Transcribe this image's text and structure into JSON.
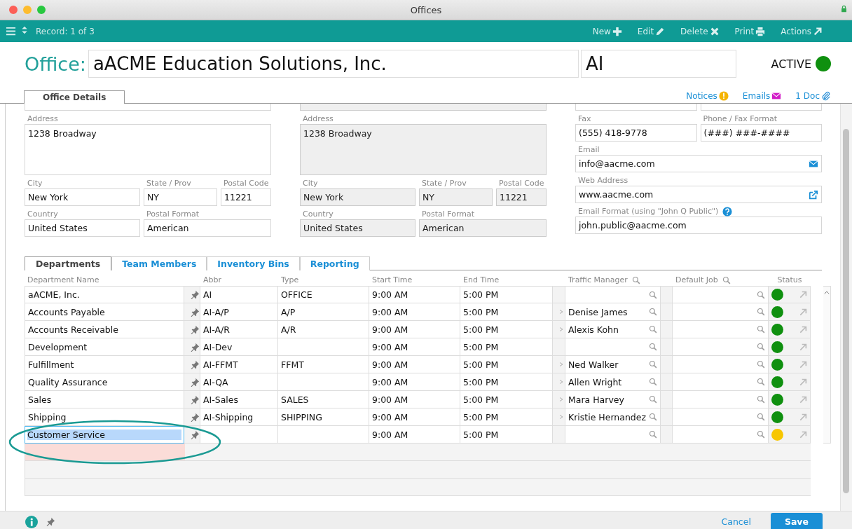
{
  "window": {
    "title": "Offices"
  },
  "toolbar": {
    "record": "Record: 1 of 3",
    "actions": [
      {
        "label": "New"
      },
      {
        "label": "Edit"
      },
      {
        "label": "Delete"
      },
      {
        "label": "Print"
      },
      {
        "label": "Actions"
      }
    ]
  },
  "header": {
    "label": "Office:",
    "name": "aACME Education Solutions, Inc.",
    "abbr": "AI",
    "status": "ACTIVE",
    "active": true
  },
  "tabs": [
    {
      "label": "Office Details",
      "selected": true
    }
  ],
  "links": [
    {
      "label": "Notices"
    },
    {
      "label": "Emails"
    },
    {
      "label": "1 Doc"
    }
  ],
  "form": [
    {
      "disabled": false,
      "rows": [
        [
          {
            "label": "Address",
            "value": "1238 Broadway",
            "kind": "multiline"
          }
        ],
        [
          {
            "label": "City",
            "value": "New York"
          },
          {
            "label": "State / Prov",
            "value": "NY"
          },
          {
            "label": "Postal Code",
            "value": "11221"
          }
        ],
        [
          {
            "label": "Country",
            "value": "United States"
          },
          {
            "label": "Postal Format",
            "value": "American"
          }
        ]
      ]
    },
    {
      "disabled": true,
      "rows": [
        [
          {
            "label": "Address",
            "value": "1238 Broadway",
            "kind": "multiline"
          }
        ],
        [
          {
            "label": "City",
            "value": "New York"
          },
          {
            "label": "State / Prov",
            "value": "NY"
          },
          {
            "label": "Postal Code",
            "value": "11221"
          }
        ],
        [
          {
            "label": "Country",
            "value": "United States"
          },
          {
            "label": "Postal Format",
            "value": "American"
          }
        ]
      ]
    },
    {
      "disabled": false,
      "rows": [
        [
          {
            "label": "Fax",
            "value": "(555) 418-9778"
          },
          {
            "label": "Phone / Fax Format",
            "value": "(###) ###-####"
          }
        ],
        [
          {
            "label": "Email",
            "value": "info@aacme.com",
            "kind": "email"
          }
        ],
        [
          {
            "label": "Web Address",
            "value": "www.aacme.com",
            "kind": "link"
          }
        ],
        [
          {
            "label": "Email Format (using \"John Q Public\")",
            "value": "john.public@aacme.com",
            "help": true
          }
        ]
      ]
    }
  ],
  "subtabs": [
    {
      "label": "Departments",
      "selected": true
    },
    {
      "label": "Team Members",
      "selected": false
    },
    {
      "label": "Inventory Bins",
      "selected": false
    },
    {
      "label": "Reporting",
      "selected": false
    }
  ],
  "table": {
    "columns": [
      {
        "label": "Department Name"
      },
      {
        "label": "Abbr"
      },
      {
        "label": "Type"
      },
      {
        "label": "Start Time"
      },
      {
        "label": "End Time"
      },
      {
        "label": "Traffic Manager",
        "search": true
      },
      {
        "label": "Default Job",
        "search": true
      },
      {
        "label": "Status"
      }
    ],
    "rows": [
      {
        "name": "aACME, Inc.",
        "abbr": "AI",
        "type": "OFFICE",
        "start": "9:00 AM",
        "end": "5:00 PM",
        "color": "#0f900f",
        "selected": false
      },
      {
        "name": "Accounts Payable",
        "abbr": "AI-A/P",
        "type": "A/P",
        "start": "9:00 AM",
        "end": "5:00 PM",
        "manager": "Denise James",
        "color": "#0f900f",
        "selected": false
      },
      {
        "name": "Accounts Receivable",
        "abbr": "AI-A/R",
        "type": "A/R",
        "start": "9:00 AM",
        "end": "5:00 PM",
        "manager": "Alexis Kohn",
        "color": "#0f900f",
        "selected": false
      },
      {
        "name": "Development",
        "abbr": "AI-Dev",
        "start": "9:00 AM",
        "end": "5:00 PM",
        "color": "#0f900f",
        "selected": false
      },
      {
        "name": "Fulfillment",
        "abbr": "AI-FFMT",
        "type": "FFMT",
        "start": "9:00 AM",
        "end": "5:00 PM",
        "manager": "Ned Walker",
        "color": "#0f900f",
        "selected": false
      },
      {
        "name": "Quality Assurance",
        "abbr": "AI-QA",
        "start": "9:00 AM",
        "end": "5:00 PM",
        "manager": "Allen Wright",
        "color": "#0f900f",
        "selected": false
      },
      {
        "name": "Sales",
        "abbr": "AI-Sales",
        "type": "SALES",
        "start": "9:00 AM",
        "end": "5:00 PM",
        "manager": "Mara Harvey",
        "color": "#0f900f",
        "selected": false
      },
      {
        "name": "Shipping",
        "abbr": "AI-Shipping",
        "type": "SHIPPING",
        "start": "9:00 AM",
        "end": "5:00 PM",
        "manager": "Kristie Hernandez",
        "color": "#0f900f",
        "selected": false
      },
      {
        "name": "Customer Service",
        "start": "9:00 AM",
        "end": "5:00 PM",
        "color": "#f7c600",
        "selected": true
      }
    ]
  },
  "footer": {
    "cancel": "Cancel",
    "save": "Save"
  }
}
